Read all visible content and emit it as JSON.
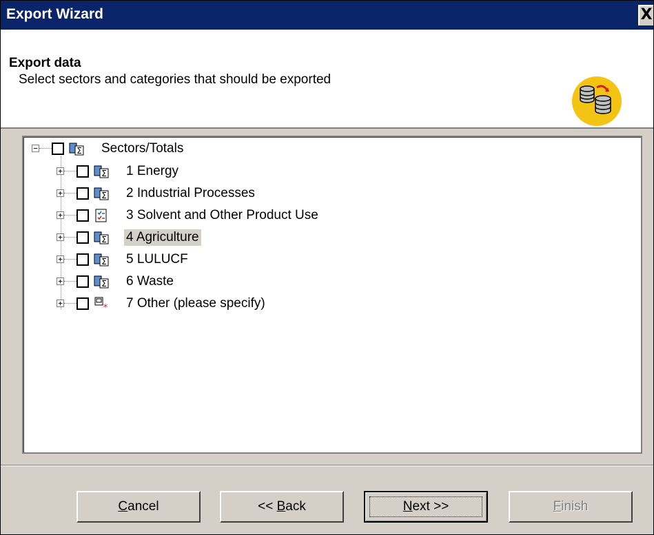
{
  "window": {
    "title": "Export Wizard",
    "close_label": "X"
  },
  "header": {
    "title": "Export data",
    "subtitle": "Select sectors and categories that should be exported",
    "logo_icon": "database-export-icon"
  },
  "tree": {
    "root": {
      "label": "Sectors/Totals",
      "expanded": true,
      "checked": false,
      "icon": "sector-sum-icon"
    },
    "items": [
      {
        "label": "1 Energy",
        "checked": false,
        "icon": "sector-sum-icon"
      },
      {
        "label": "2 Industrial Processes",
        "checked": false,
        "icon": "sector-sum-icon"
      },
      {
        "label": "3 Solvent and Other Product Use",
        "checked": false,
        "icon": "checklist-icon"
      },
      {
        "label": "4 Agriculture",
        "checked": false,
        "icon": "sector-sum-icon",
        "selected": true
      },
      {
        "label": "5 LULUCF",
        "checked": false,
        "icon": "sector-sum-icon"
      },
      {
        "label": "6 Waste",
        "checked": false,
        "icon": "sector-sum-icon"
      },
      {
        "label": "7 Other (please specify)",
        "checked": false,
        "icon": "other-asterisk-icon"
      }
    ]
  },
  "buttons": {
    "cancel": {
      "label": "Cancel",
      "mnemonic": "C"
    },
    "back": {
      "label": "<< Back",
      "mnemonic": "B"
    },
    "next": {
      "label": "Next >>",
      "mnemonic": "N"
    },
    "finish": {
      "label": "Finish",
      "mnemonic": "F",
      "disabled": true
    }
  },
  "colors": {
    "titlebar": "#0a246a",
    "face": "#d4d0c8",
    "logo_bg": "#f4c414"
  }
}
